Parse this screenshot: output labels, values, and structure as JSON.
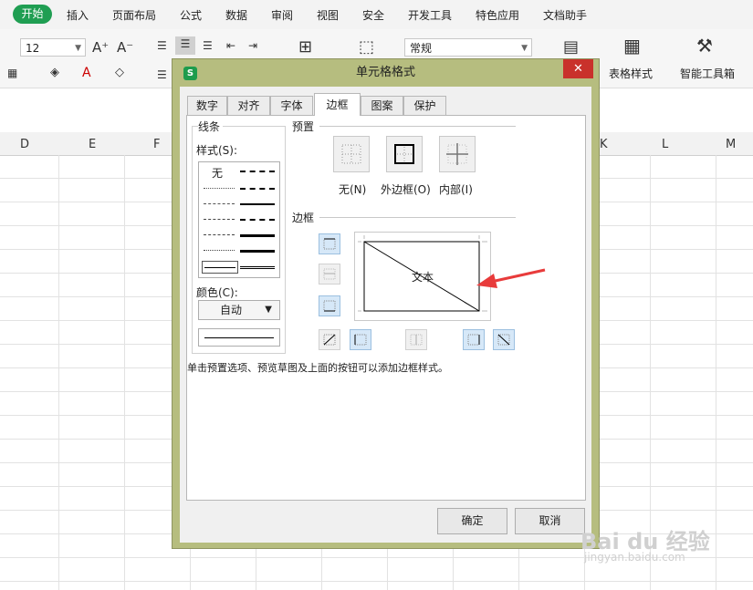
{
  "menu": {
    "active_tab": "开始",
    "items": [
      "插入",
      "页面布局",
      "公式",
      "数据",
      "审阅",
      "视图",
      "安全",
      "开发工具",
      "特色应用",
      "文档助手"
    ]
  },
  "toolbar": {
    "font_size": "12",
    "number_format": "常规",
    "table_style_label": "表格样式",
    "smart_toolbox_label": "智能工具箱"
  },
  "columns": [
    "D",
    "E",
    "F",
    "K",
    "L",
    "M"
  ],
  "dialog": {
    "title": "单元格格式",
    "app_icon": "S",
    "close_glyph": "✕",
    "tabs": [
      {
        "label": "数字"
      },
      {
        "label": "对齐"
      },
      {
        "label": "字体"
      },
      {
        "label": "边框",
        "active": true
      },
      {
        "label": "图案"
      },
      {
        "label": "保护"
      }
    ],
    "line_group": {
      "title": "线条",
      "style_label": "样式(S):",
      "none_label": "无",
      "color_label": "颜色(C):",
      "color_value": "自动"
    },
    "preset": {
      "title": "预置",
      "none_label": "无(N)",
      "outline_label": "外边框(O)",
      "inside_label": "内部(I)"
    },
    "border": {
      "title": "边框",
      "preview_text": "文本"
    },
    "hint": "单击预置选项、预览草图及上面的按钮可以添加边框样式。",
    "ok_label": "确定",
    "cancel_label": "取消"
  },
  "watermark": {
    "text": "Bai du 经验",
    "url": "jingyan.baidu.com"
  },
  "colors": {
    "accent_green": "#1f9e52",
    "dialog_frame": "#b6bd7f",
    "close_red": "#c9312b",
    "annotation_arrow": "#e83b3b",
    "border_button_active": "#d6e8f8"
  }
}
